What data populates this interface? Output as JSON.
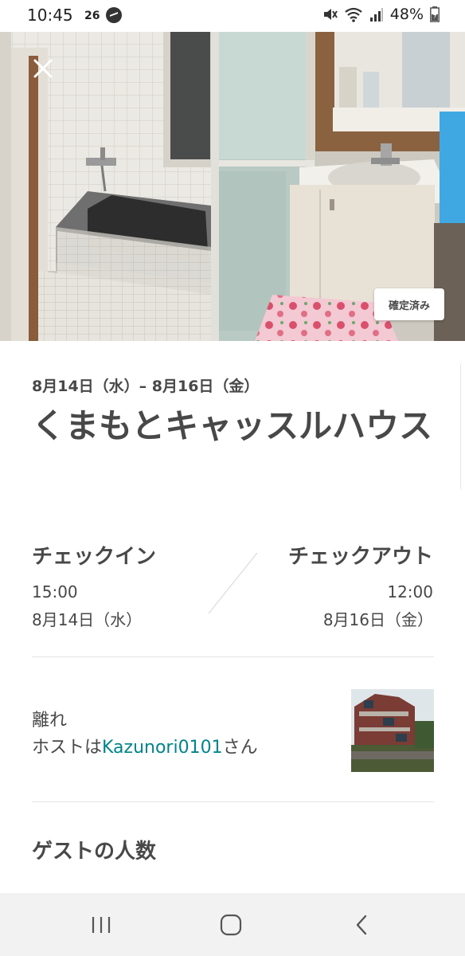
{
  "status_bar": {
    "time": "10:45",
    "temperature": "26",
    "battery": "48%",
    "icons": [
      "temperature-icon",
      "messenger-icon",
      "mute-icon",
      "wifi-icon",
      "signal-icon",
      "battery-icon"
    ]
  },
  "hero": {
    "badge": "確定済み",
    "close_icon": "close-icon"
  },
  "reservation": {
    "dates": "8月14日（水）– 8月16日（金）",
    "title": "くまもとキャッスルハウス"
  },
  "checkin": {
    "label": "チェックイン",
    "time": "15:00",
    "date": "8月14日（水）"
  },
  "checkout": {
    "label": "チェックアウト",
    "time": "12:00",
    "date": "8月16日（金）"
  },
  "listing": {
    "room_type": "離れ",
    "host_prefix": "ホストは",
    "host_name": "Kazunori0101",
    "host_suffix": "さん"
  },
  "guests": {
    "title": "ゲストの人数"
  },
  "nav_bar": {
    "icons": [
      "recent-apps-icon",
      "home-icon",
      "back-icon"
    ]
  },
  "colors": {
    "text": "#484848",
    "link": "#008489",
    "nav_bg": "#f2f2f2"
  }
}
